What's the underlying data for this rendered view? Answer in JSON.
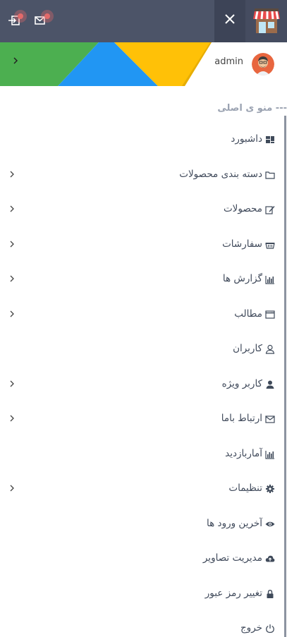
{
  "topbar": {
    "icons": [
      "logout-icon",
      "mail-icon",
      "close-icon",
      "store-logo-icon"
    ]
  },
  "profile": {
    "username": "admin"
  },
  "menu": {
    "header": "--- منو ی اصلی",
    "items": [
      {
        "label": "داشبورد",
        "icon": "dashboard-icon",
        "has_submenu": false
      },
      {
        "label": "دسته بندی محصولات",
        "icon": "folder-icon",
        "has_submenu": true
      },
      {
        "label": "محصولات",
        "icon": "edit-icon",
        "has_submenu": true
      },
      {
        "label": "سفارشات",
        "icon": "basket-icon",
        "has_submenu": true
      },
      {
        "label": "گزارش ها",
        "icon": "bar-chart-icon",
        "has_submenu": true
      },
      {
        "label": "مطالب",
        "icon": "window-icon",
        "has_submenu": true
      },
      {
        "label": "کاربران",
        "icon": "user-outline-icon",
        "has_submenu": false
      },
      {
        "label": "کاربر ویژه",
        "icon": "user-icon",
        "has_submenu": true
      },
      {
        "label": "ارتباط باما",
        "icon": "envelope-icon",
        "has_submenu": true
      },
      {
        "label": "آماربازدید",
        "icon": "bar-chart-icon",
        "has_submenu": false
      },
      {
        "label": "تنظیمات",
        "icon": "gear-icon",
        "has_submenu": true
      },
      {
        "label": "آخرین ورود ها",
        "icon": "eye-icon",
        "has_submenu": false
      },
      {
        "label": "مدیریت تصاویر",
        "icon": "cloud-upload-icon",
        "has_submenu": false
      },
      {
        "label": "تغییر رمز عبور",
        "icon": "lock-icon",
        "has_submenu": false
      },
      {
        "label": "خروج",
        "icon": "power-icon",
        "has_submenu": false
      }
    ]
  },
  "colors": {
    "topbar": "#4c5468",
    "banner_green": "#4caf50",
    "banner_blue": "#2196f3",
    "banner_yellow": "#ffc107",
    "text": "#404a5b",
    "header_text": "#9aa2b1"
  }
}
